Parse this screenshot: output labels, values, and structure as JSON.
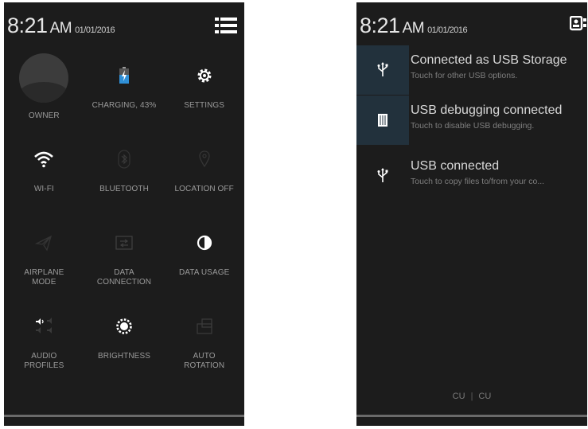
{
  "left_screen": {
    "status": {
      "time": "8:21",
      "ampm": "AM",
      "date": "01/01/2016"
    },
    "tiles": [
      {
        "label": "OWNER",
        "icon": "avatar"
      },
      {
        "label": "CHARGING, 43%",
        "icon": "battery-charging-icon"
      },
      {
        "label": "SETTINGS",
        "icon": "gear-icon"
      },
      {
        "label": "WI-FI",
        "icon": "wifi-icon"
      },
      {
        "label": "BLUETOOTH",
        "icon": "bluetooth-icon"
      },
      {
        "label": "LOCATION OFF",
        "icon": "location-icon"
      },
      {
        "label": "AIRPLANE\nMODE",
        "icon": "airplane-icon"
      },
      {
        "label": "DATA\nCONNECTION",
        "icon": "data-connection-icon"
      },
      {
        "label": "DATA USAGE",
        "icon": "data-usage-icon"
      },
      {
        "label": "AUDIO\nPROFILES",
        "icon": "audio-profiles-icon"
      },
      {
        "label": "BRIGHTNESS",
        "icon": "brightness-icon"
      },
      {
        "label": "AUTO\nROTATION",
        "icon": "auto-rotation-icon"
      }
    ]
  },
  "right_screen": {
    "status": {
      "time": "8:21",
      "ampm": "AM",
      "date": "01/01/2016"
    },
    "notifications": [
      {
        "title": "Connected as USB Storage",
        "subtitle": "Touch for other USB options.",
        "icon": "usb-icon"
      },
      {
        "title": "USB debugging connected",
        "subtitle": "Touch to disable USB debugging.",
        "icon": "usb-debugging-icon"
      },
      {
        "title": "USB connected",
        "subtitle": "Touch to copy files to/from your co...",
        "icon": "usb-icon"
      }
    ],
    "carrier": {
      "sim1": "CU",
      "sim2": "CU",
      "separator": "|"
    }
  },
  "colors": {
    "background": "#1c1c1c",
    "active_icon": "#ffffff",
    "inactive_icon": "#3a3a3a",
    "battery_accent": "#2f8fd6",
    "highlight_box": "#22313c"
  }
}
